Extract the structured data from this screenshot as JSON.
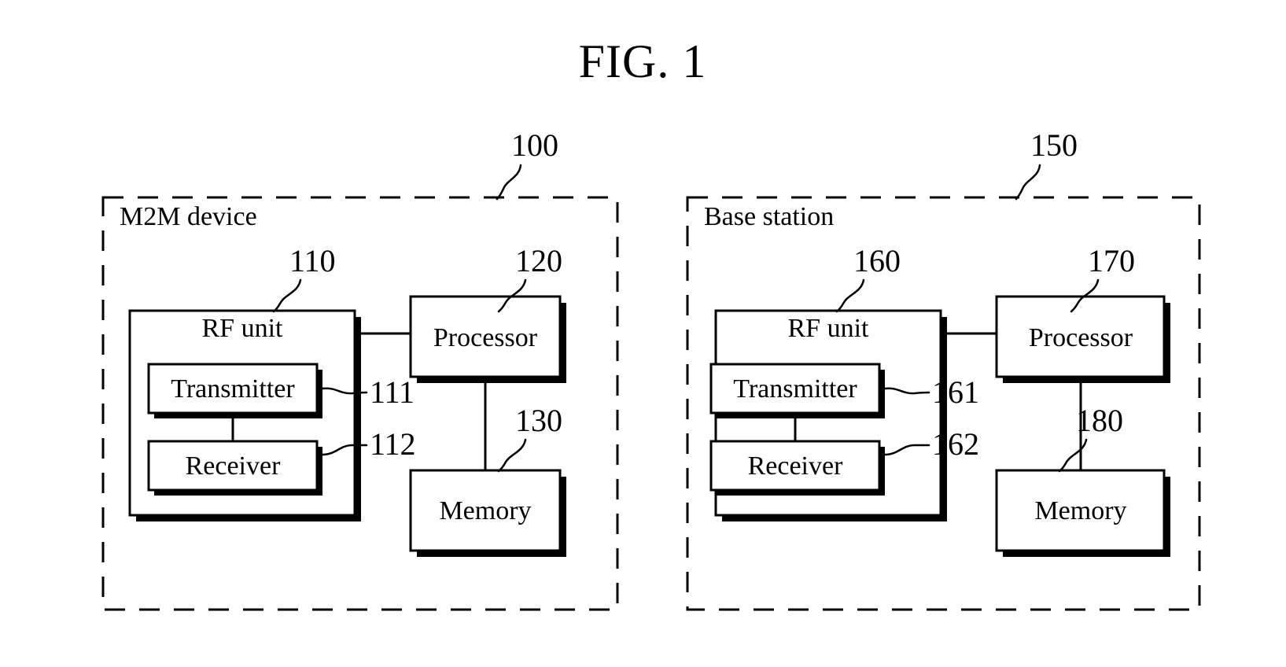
{
  "figure": {
    "title": "FIG. 1",
    "type": "patent block diagram"
  },
  "panels": [
    {
      "id": "m2m-device",
      "label": "M2M device",
      "ref": "100",
      "blocks": [
        {
          "id": "rf-unit",
          "label": "RF unit",
          "ref": "110"
        },
        {
          "id": "transmitter",
          "label": "Transmitter",
          "ref": "111"
        },
        {
          "id": "receiver",
          "label": "Receiver",
          "ref": "112"
        },
        {
          "id": "processor",
          "label": "Processor",
          "ref": "120"
        },
        {
          "id": "memory",
          "label": "Memory",
          "ref": "130"
        }
      ]
    },
    {
      "id": "base-station",
      "label": "Base station",
      "ref": "150",
      "blocks": [
        {
          "id": "rf-unit",
          "label": "RF unit",
          "ref": "160"
        },
        {
          "id": "transmitter",
          "label": "Transmitter",
          "ref": "161"
        },
        {
          "id": "receiver",
          "label": "Receiver",
          "ref": "162"
        },
        {
          "id": "processor",
          "label": "Processor",
          "ref": "170"
        },
        {
          "id": "memory",
          "label": "Memory",
          "ref": "180"
        }
      ]
    }
  ],
  "colors": {
    "line": "#000000",
    "background": "#ffffff",
    "fill": "#ffffff"
  }
}
